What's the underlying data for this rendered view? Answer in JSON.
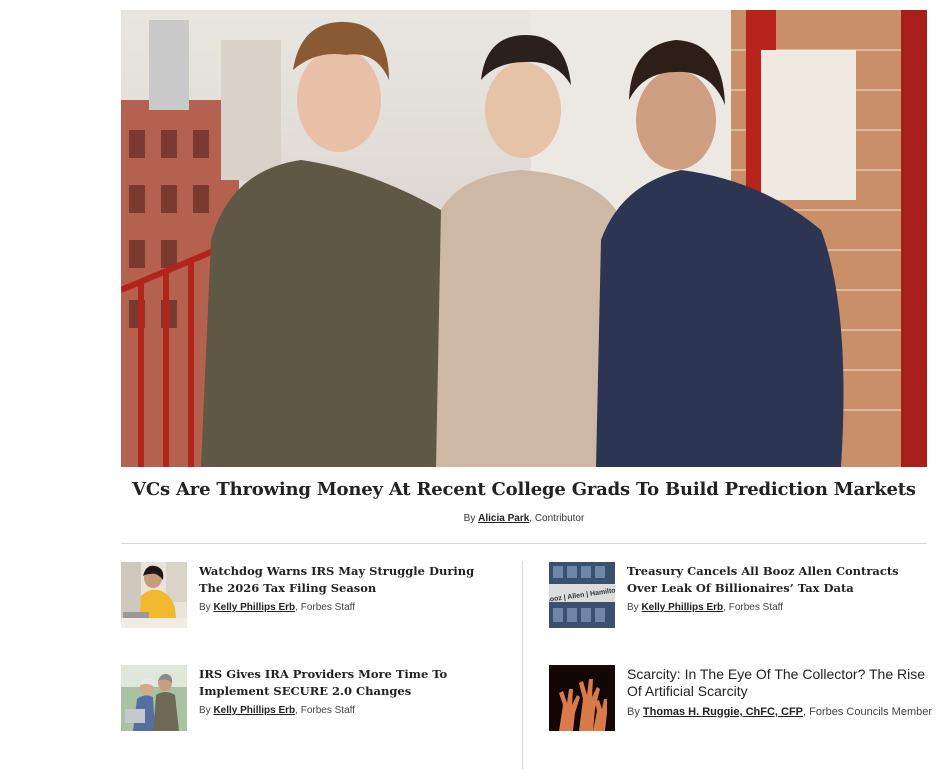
{
  "hero": {
    "headline": "VCs Are Throwing Money At Recent College Grads To Build Prediction Markets",
    "by": "By",
    "author": "Alicia Park",
    "role": ", Contributor"
  },
  "articles": [
    {
      "title": "Watchdog Warns IRS May Struggle During The 2026 Tax Filing Season",
      "by": "By",
      "author": "Kelly Phillips Erb",
      "role": ", Forbes Staff"
    },
    {
      "title": "Treasury Cancels All Booz Allen Contracts Over Leak Of Billionaires’ Tax Data",
      "by": "By",
      "author": "Kelly Phillips Erb",
      "role": ", Forbes Staff",
      "thumb_sign": "Booz | Allen | Hamilton"
    },
    {
      "title": "IRS Gives IRA Providers More Time To Implement SECURE 2.0 Changes",
      "by": "By",
      "author": "Kelly Phillips Erb",
      "role": ", Forbes Staff"
    },
    {
      "title": "Scarcity: In The Eye Of The Collector? The Rise Of Artificial Scarcity",
      "by": "By",
      "author": "Thomas H. Ruggie, ChFC, CFP",
      "role": ", Forbes Councils Member"
    }
  ]
}
